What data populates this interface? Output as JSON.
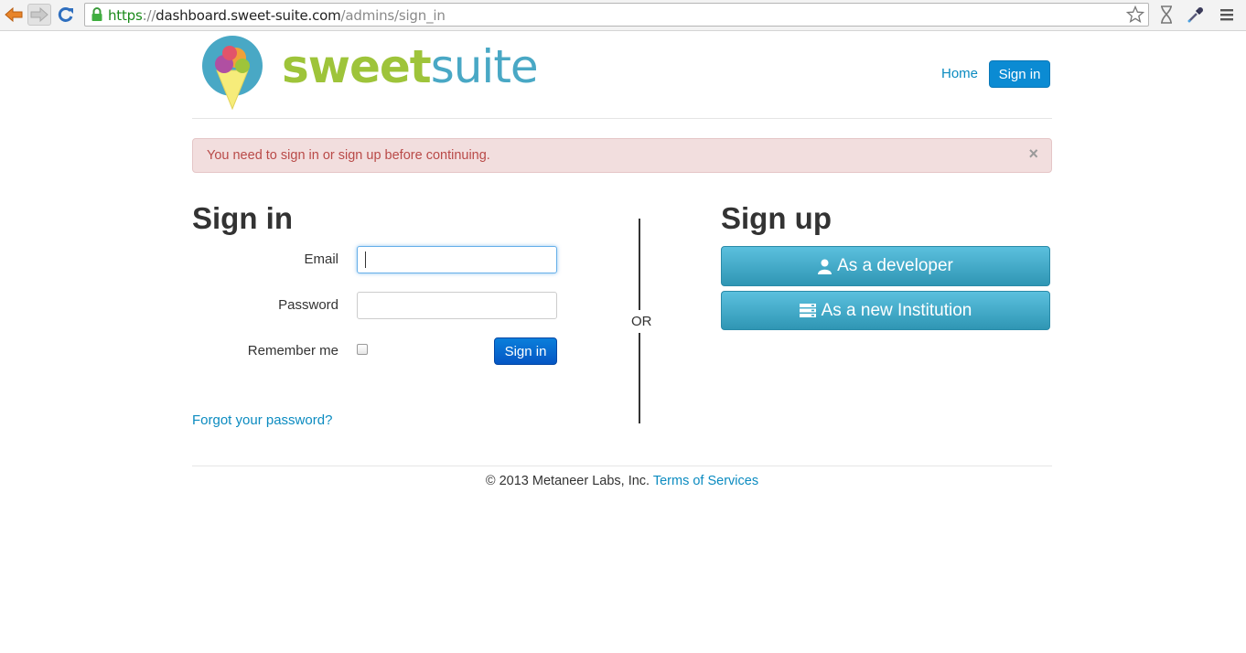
{
  "browser": {
    "url_scheme": "https",
    "url_separator": "://",
    "url_host": "dashboard.sweet-suite.com",
    "url_path": "/admins/sign_in"
  },
  "header": {
    "logo_word_1": "sweet",
    "logo_word_2": "suite",
    "nav_home": "Home",
    "nav_signin": "Sign in"
  },
  "alert": {
    "message": "You need to sign in or sign up before continuing.",
    "close": "×"
  },
  "signin": {
    "heading": "Sign in",
    "email_label": "Email",
    "email_value": "",
    "password_label": "Password",
    "password_value": "",
    "remember_label": "Remember me",
    "remember_checked": false,
    "submit": "Sign in",
    "forgot": "Forgot your password?"
  },
  "divider": {
    "text": "OR"
  },
  "signup": {
    "heading": "Sign up",
    "developer_button": "As a developer",
    "institution_button": "As a new Institution"
  },
  "footer": {
    "copyright": "© 2013 Metaneer Labs, Inc.",
    "terms": "Terms of Services"
  },
  "icons": [
    "back-arrow-icon",
    "forward-arrow-icon",
    "reload-icon",
    "lock-icon",
    "bookmark-star-icon",
    "hourglass-icon",
    "eyedropper-icon",
    "menu-icon",
    "ice-cream-logo-icon",
    "user-icon",
    "server-icon"
  ],
  "colors": {
    "brand_green": "#9ec43a",
    "brand_blue": "#49a8c5",
    "link": "#0b8bc0",
    "alert_bg": "#f2dede",
    "alert_text": "#b94a48",
    "info_button": "#49afcd",
    "primary_button": "#0556c4"
  }
}
